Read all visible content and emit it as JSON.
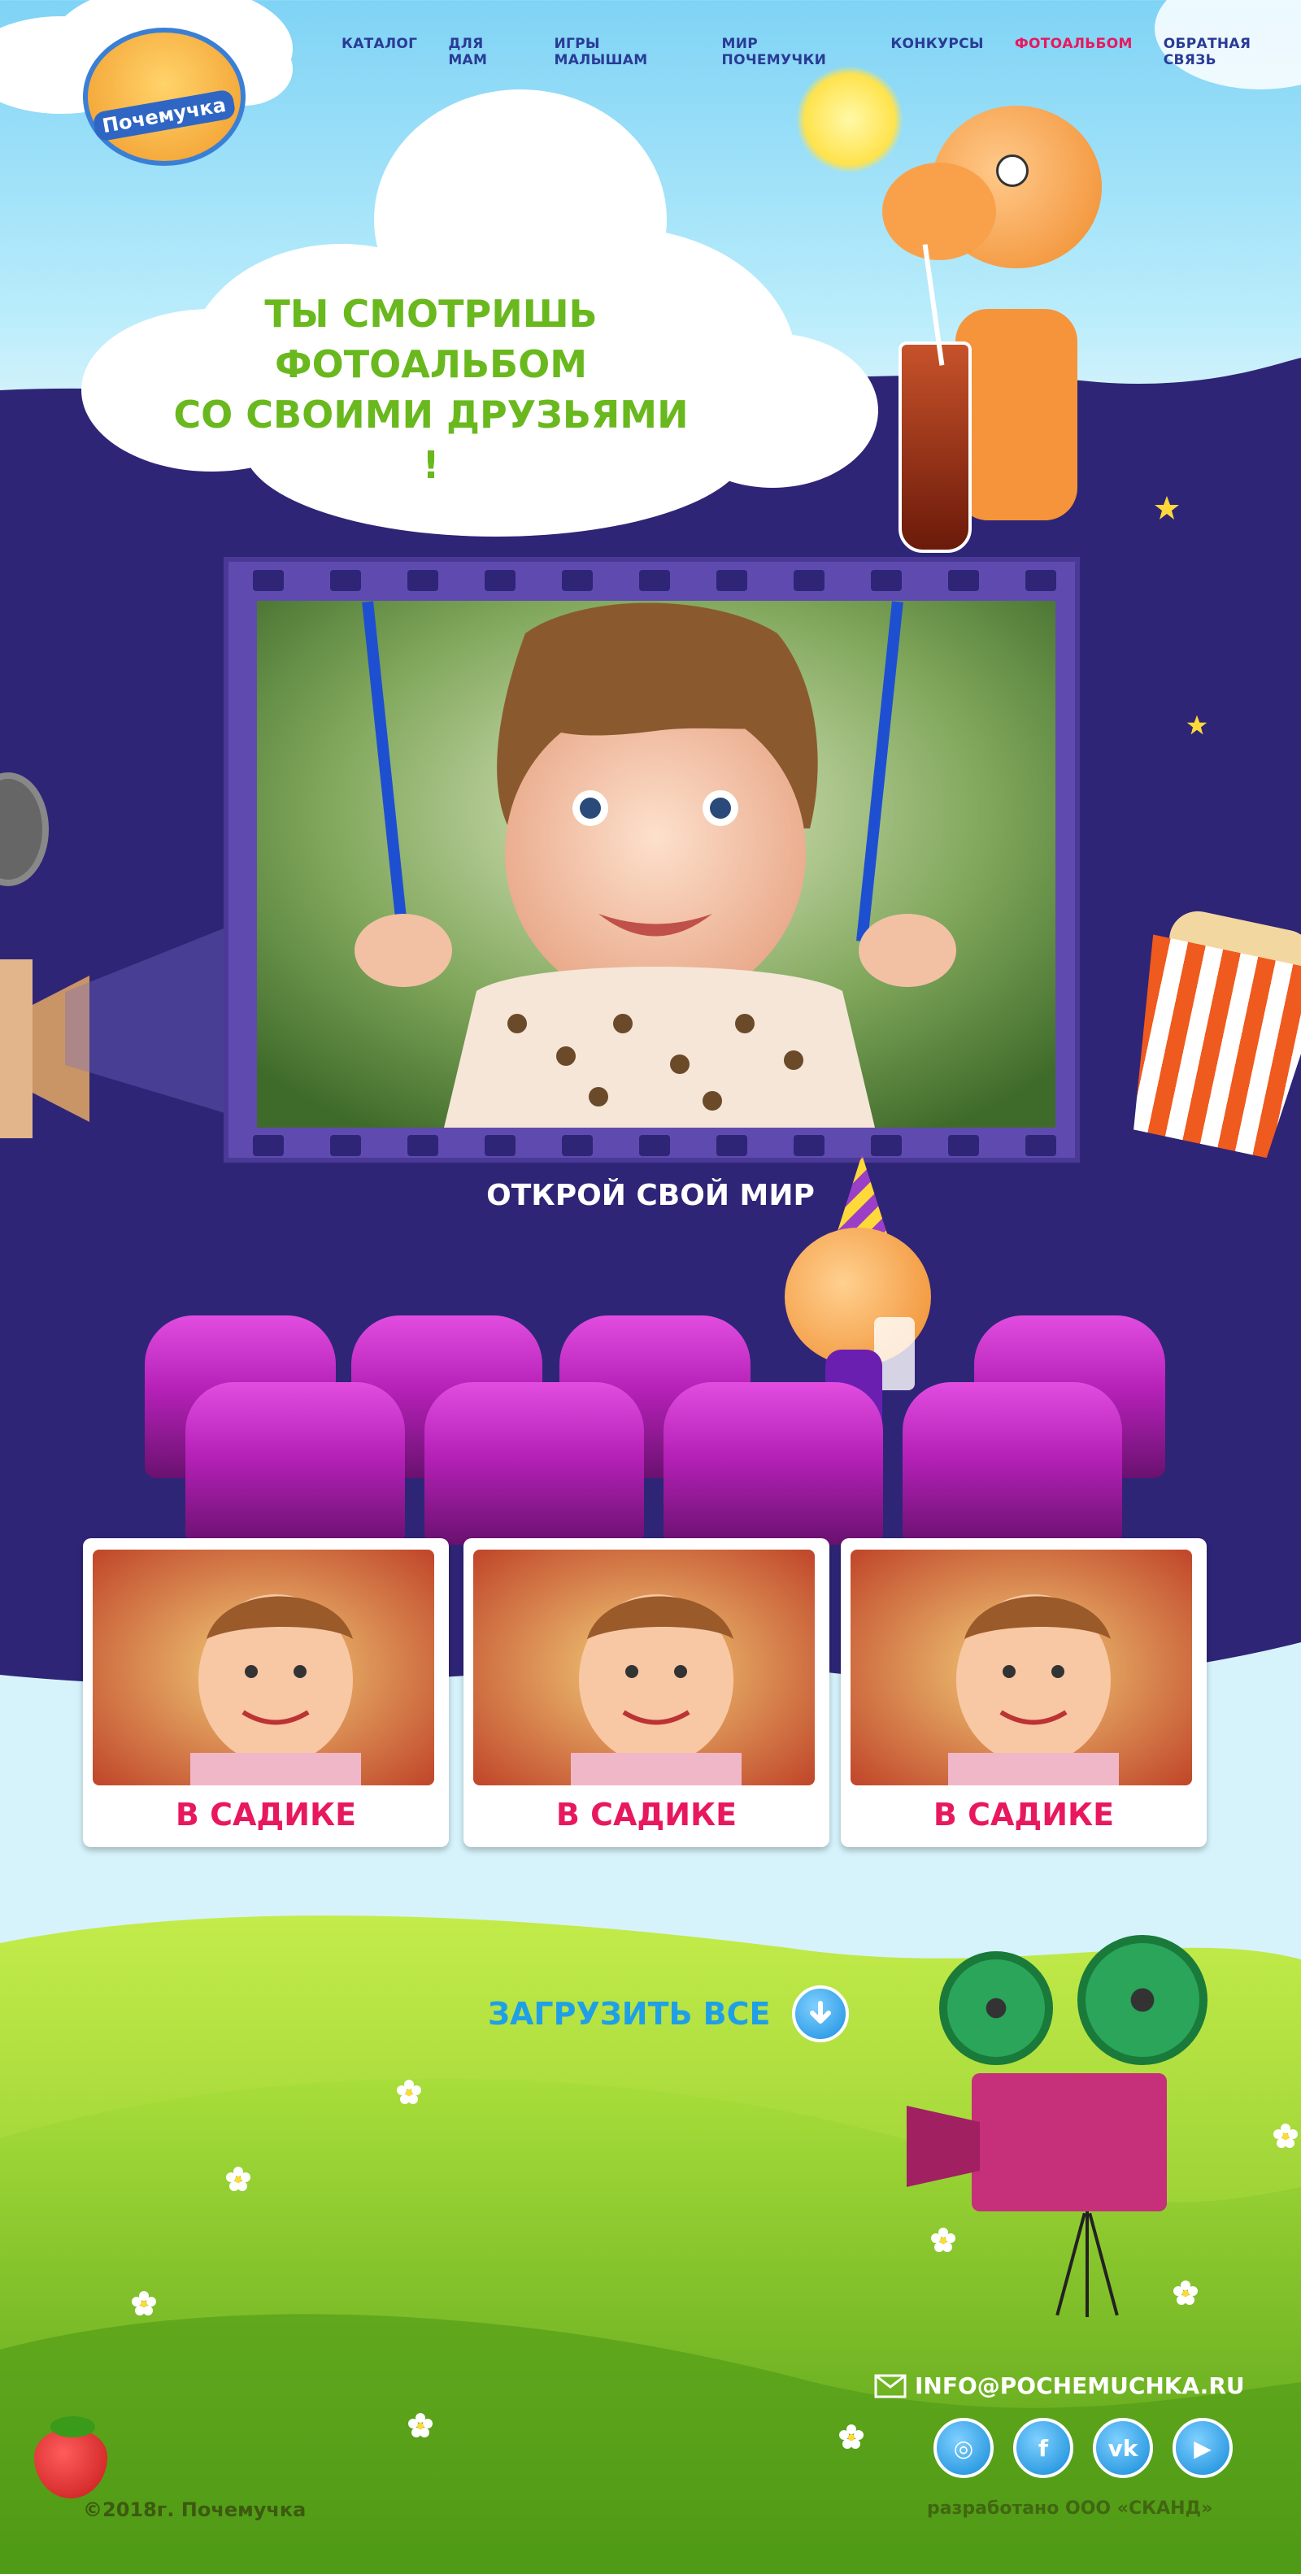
{
  "brand": {
    "logo_text": "Почемучка"
  },
  "nav": {
    "items": [
      {
        "label": "КАТАЛОГ"
      },
      {
        "label": "ДЛЯ МАМ"
      },
      {
        "label": "ИГРЫ МАЛЫШАМ"
      },
      {
        "label": "МИР ПОЧЕМУЧКИ"
      },
      {
        "label": "КОНКУРСЫ"
      },
      {
        "label": "ФОТОАЛЬБОМ",
        "active": true
      },
      {
        "label": "ОБРАТНАЯ СВЯЗЬ"
      }
    ]
  },
  "hero": {
    "title_line1": "ТЫ СМОТРИШЬ ФОТОАЛЬБОМ",
    "title_line2": "СО СВОИМИ ДРУЗЬЯМИ !"
  },
  "gallery": {
    "subtitle": "ОТКРОЙ СВОЙ МИР",
    "cards": [
      {
        "caption": "В САДИКЕ"
      },
      {
        "caption": "В САДИКЕ"
      },
      {
        "caption": "В САДИКЕ"
      }
    ],
    "load_all": "ЗАГРУЗИТЬ ВСЕ"
  },
  "footer": {
    "email": "INFO@POCHEMUCHKA.RU",
    "social": [
      {
        "icon": "instagram-icon",
        "glyph": "◎"
      },
      {
        "icon": "facebook-icon",
        "glyph": "f"
      },
      {
        "icon": "vk-icon",
        "glyph": "vk"
      },
      {
        "icon": "youtube-icon",
        "glyph": "▶"
      }
    ],
    "copyright": "©2018г. Почемучка",
    "developer": "разработано ООО «СКАНД»"
  },
  "colors": {
    "purple": "#2e2577",
    "nav_text": "#2a3b96",
    "nav_active": "#e8185f",
    "hero_green": "#69b81e",
    "caption_pink": "#e8185f",
    "load_blue": "#1fa0e6"
  }
}
